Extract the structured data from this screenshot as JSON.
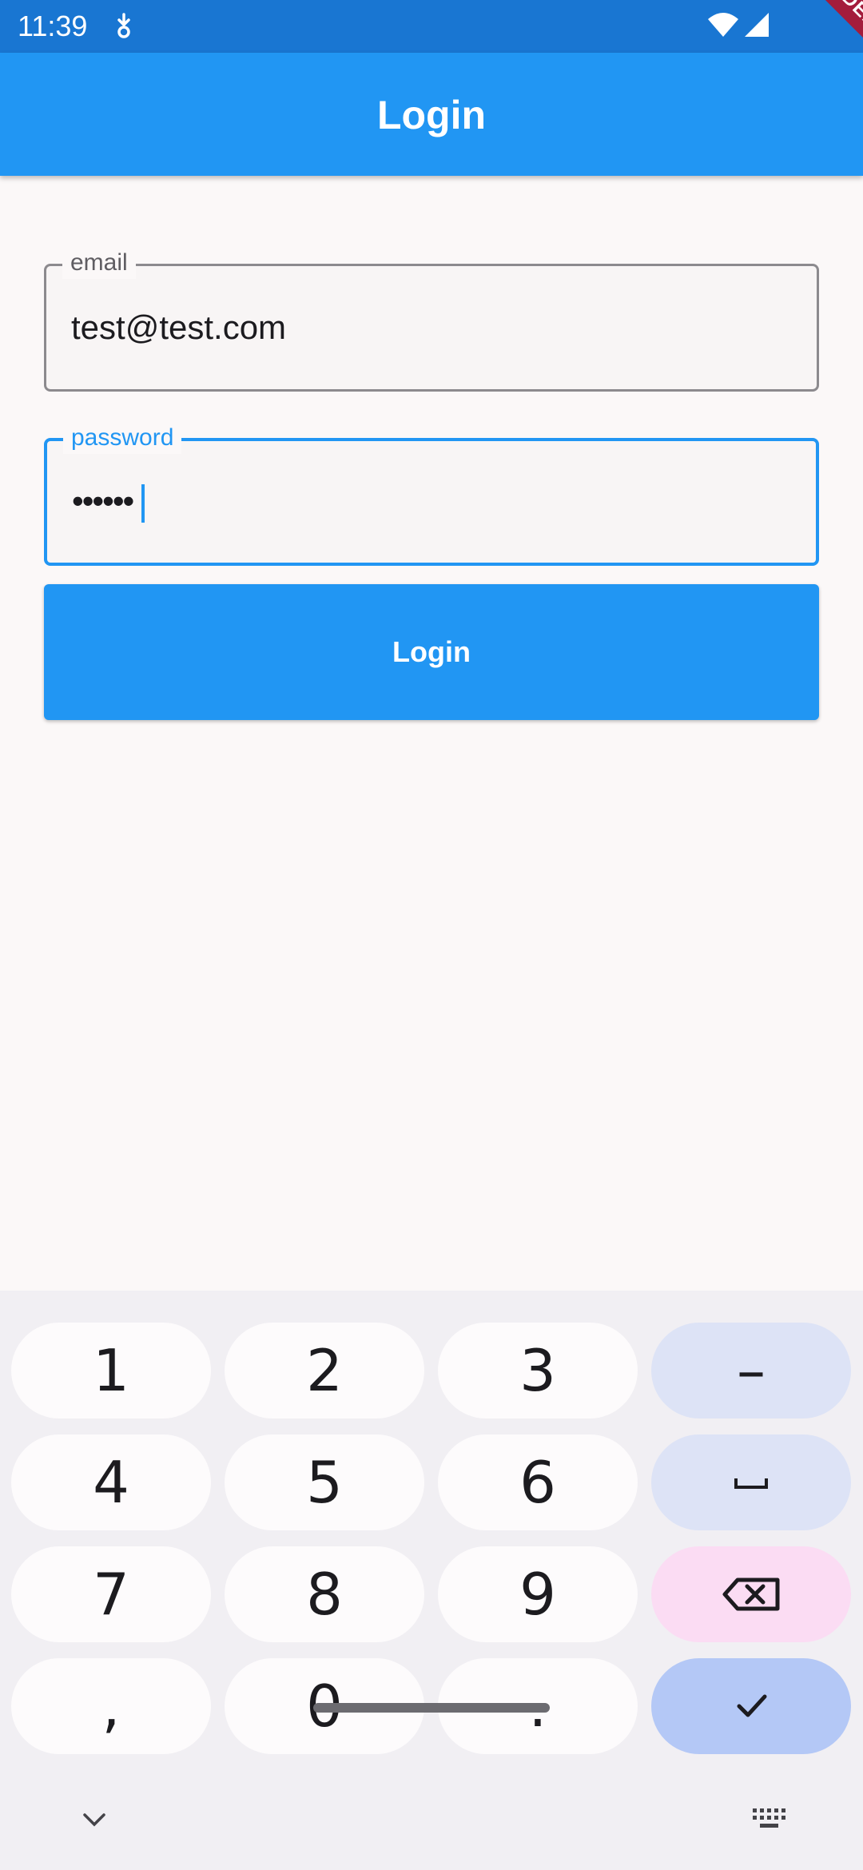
{
  "status_bar": {
    "time": "11:39",
    "icons": [
      "download-notification-icon",
      "wifi-icon",
      "cell-signal-icon"
    ]
  },
  "debug_banner": "DEBUG",
  "app_bar": {
    "title": "Login"
  },
  "form": {
    "email": {
      "label": "email",
      "value": "test@test.com"
    },
    "password": {
      "label": "password",
      "value": "••••••"
    },
    "login_button": "Login"
  },
  "keyboard": {
    "keys": {
      "k1": "1",
      "k2": "2",
      "k3": "3",
      "minus": "–",
      "k4": "4",
      "k5": "5",
      "k6": "6",
      "k7": "7",
      "k8": "8",
      "k9": "9",
      "comma": ",",
      "k0": "0",
      "period": "."
    },
    "icons": [
      "space-icon",
      "backspace-icon",
      "checkmark-icon",
      "chevron-down-icon",
      "keyboard-icon"
    ]
  },
  "colors": {
    "status_bar": "#1976d2",
    "primary": "#2196f3",
    "background": "#fbf8f8",
    "debug_banner": "#a41c3c",
    "key_fn": "#dde3f6",
    "key_delete": "#fbdcf3",
    "key_enter": "#b4c8f6"
  }
}
